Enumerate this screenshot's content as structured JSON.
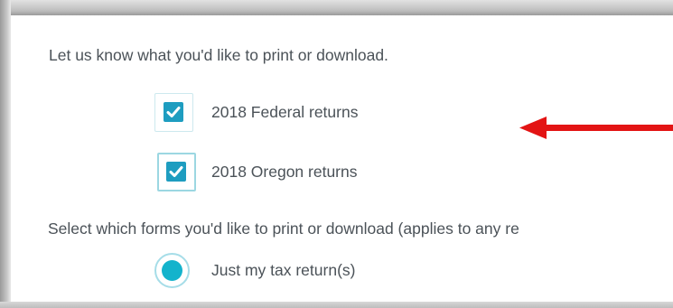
{
  "print_options": {
    "intro": "Let us know what you'd like to print or download.",
    "returns": [
      {
        "label": "2018 Federal returns",
        "checked": true
      },
      {
        "label": "2018 Oregon returns",
        "checked": true
      }
    ],
    "forms_prompt": "Select which forms you'd like to print or download (applies to any re",
    "forms_options": [
      {
        "label": "Just my tax return(s)",
        "selected": true
      }
    ]
  },
  "annotation": {
    "arrow_color": "#e31414",
    "arrow_icon": "red-arrow-icon"
  },
  "colors": {
    "accent": "#1e9dc0",
    "radio_fill": "#14b3cc",
    "text": "#4b5258"
  }
}
